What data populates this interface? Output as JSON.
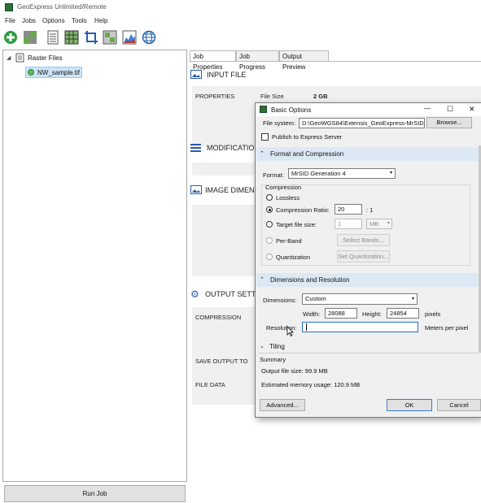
{
  "window": {
    "title": "GeoExpress Unlimited/Remote"
  },
  "menu": [
    "File",
    "Jobs",
    "Options",
    "Tools",
    "Help"
  ],
  "toolbar": {
    "icons": [
      "add-icon",
      "raster-icon",
      "document-icon",
      "grid-icon",
      "crop-icon",
      "mosaic-icon",
      "histogram-icon",
      "globe-icon"
    ]
  },
  "tree": {
    "root": "Raster Files",
    "file": "NW_sample.tif"
  },
  "run_button": "Run Job",
  "tabs": [
    "Job Properties",
    "Job Progress",
    "Output Preview"
  ],
  "job": {
    "input_file": "INPUT FILE",
    "properties": "PROPERTIES",
    "file_size_label": "File Size",
    "file_size_value": "2 GB",
    "modification": "MODIFICATION",
    "image_dimensions": "IMAGE DIMENSI",
    "output_settings": "OUTPUT SETTIN",
    "compression": "COMPRESSION",
    "save_output_to": "SAVE OUTPUT TO",
    "file_data": "FILE DATA"
  },
  "dialog": {
    "title": "Basic Options",
    "controls": {
      "minimize": "—",
      "maximize": "☐",
      "close": "✕"
    },
    "file_system_label": "File system:",
    "file_system_value": "D:\\GeoWGS84\\Extensis_GeoExpress-MrSID_\\",
    "browse": "Browse...",
    "publish": "Publish to Express Server",
    "format_compression": "Format and Compression",
    "format_label": "Format:",
    "format_value": "MrSID Generation 4",
    "compression_group": "Compression",
    "lossless": "Lossless",
    "compression_ratio": "Compression Ratio:",
    "ratio_value": "20",
    "ratio_suffix": ": 1",
    "target_file_size": "Target file size:",
    "target_value": "1",
    "target_unit": "MB",
    "per_band": "Per-Band",
    "select_bands": "Select Bands...",
    "quantization": "Quantization",
    "set_quantization": "Set Quantization...",
    "dims_resolution": "Dimensions and Resolution",
    "dimensions_label": "Dimensions:",
    "dimensions_value": "Custom",
    "width_label": "Width:",
    "width_value": "28088",
    "height_label": "Height:",
    "height_value": "24854",
    "pixels": "pixels",
    "resolution_label": "Resolution:",
    "resolution_value": "",
    "meters_per_pixel": "Meters per pixel",
    "tiling": "Tiling",
    "summary": "Summary",
    "output_size": "Output file size: 99.9 MB",
    "memory": "Estimated memory usage: 120.9 MB",
    "advanced": "Advanced...",
    "ok": "OK",
    "cancel": "Cancel"
  }
}
